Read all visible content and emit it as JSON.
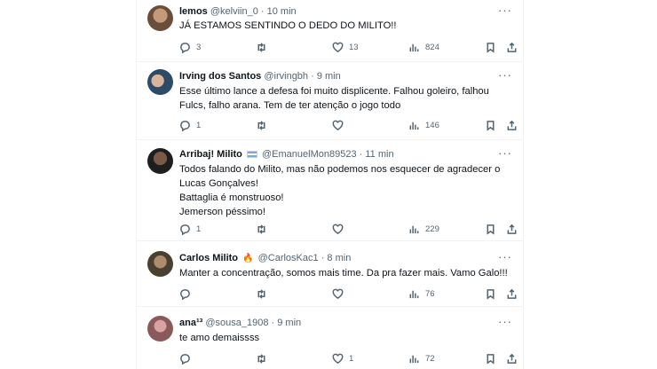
{
  "tweets": [
    {
      "name": "lemos",
      "badge": "",
      "handle": "@kelviin_0",
      "time": "· 10 min",
      "text": "JÁ ESTAMOS SENTINDO O DEDO DO MILITO!!",
      "replies": "3",
      "retweets": "",
      "likes": "13",
      "views": "824",
      "avatar_color": "#8a6a52"
    },
    {
      "name": "Irving dos Santos",
      "badge": "",
      "handle": "@irvingbh",
      "time": "· 9 min",
      "text": "Esse último lance a defesa foi muito displicente. Falhou goleiro, falhou Fulcs, falho arana. Tem de ter atenção o jogo todo",
      "replies": "1",
      "retweets": "",
      "likes": "",
      "views": "146",
      "avatar_color": "#3a5a78"
    },
    {
      "name": "Arribaj! Milito",
      "badge": "flag",
      "handle": "@EmanuelMon89523",
      "time": "· 11 min",
      "text": "Todos falando do Milito, mas não podemos nos esquecer de agradecer o Lucas Gonçalves!\nBattaglia é monstruoso!\nJemerson péssimo!",
      "replies": "1",
      "retweets": "",
      "likes": "",
      "views": "229",
      "avatar_color": "#2b2b2b"
    },
    {
      "name": "Carlos Milito",
      "badge": "torch",
      "handle": "@CarlosKac1",
      "time": "· 8 min",
      "text": "Manter a concentração, somos mais time. Da pra fazer mais. Vamo Galo!!!",
      "replies": "",
      "retweets": "",
      "likes": "",
      "views": "76",
      "avatar_color": "#5b5040"
    },
    {
      "name": "ana¹³",
      "badge": "",
      "handle": "@sousa_1908",
      "time": "· 9 min",
      "text": "te amo demaissss",
      "replies": "",
      "retweets": "",
      "likes": "1",
      "views": "72",
      "avatar_color": "#b07a7a"
    }
  ],
  "icons": {
    "more": "more-icon",
    "reply": "reply-icon",
    "retweet": "retweet-icon",
    "like": "heart-icon",
    "views": "views-icon",
    "bookmark": "bookmark-icon",
    "share": "share-icon"
  },
  "colors": {
    "text": "#0f1419",
    "secondary": "#536471",
    "border": "#eff3f4"
  }
}
